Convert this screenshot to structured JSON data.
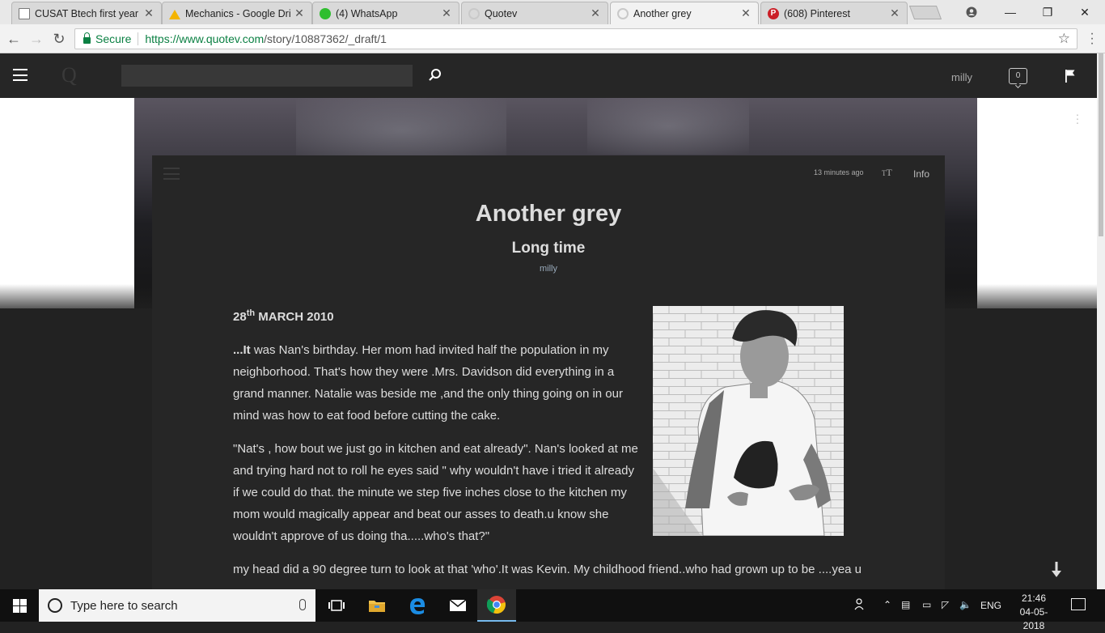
{
  "browser": {
    "tabs": [
      {
        "title": "CUSAT Btech first year n",
        "icon": "document-icon"
      },
      {
        "title": "Mechanics - Google Dri",
        "icon": "google-drive-icon"
      },
      {
        "title": "(4) WhatsApp",
        "icon": "whatsapp-icon"
      },
      {
        "title": "Quotev",
        "icon": "quotev-icon"
      },
      {
        "title": "Another grey",
        "icon": "quotev-icon",
        "active": true
      },
      {
        "title": "(608) Pinterest",
        "icon": "pinterest-icon"
      }
    ],
    "tab_close": "✕",
    "security_label": "Secure",
    "url_host": "https://www.quotev.com",
    "url_path": "/story/10887362/_draft/1"
  },
  "site": {
    "logo": "Q",
    "username": "milly",
    "notification_count": "0",
    "search_placeholder": ""
  },
  "reader": {
    "timestamp": "13 minutes ago",
    "text_size_big": "T",
    "text_size_small": "T",
    "info_label": "Info",
    "story_title": "Another grey",
    "chapter_title": "Long time",
    "author": "milly",
    "date_day": "28",
    "date_sup": "th",
    "date_rest": " MARCH 2010",
    "p1_lead": "...It",
    "p1_text": " was Nan's birthday. Her mom had invited half the population  in my neighborhood. That's how they were .Mrs. Davidson did everything in a grand manner. Natalie was beside me ,and the only thing going on in our mind was how to eat food before cutting the cake.",
    "p2_text": "\"Nat's , how bout we just go in kitchen and eat already\". Nan's looked at me and trying hard not to roll he eyes said \" why wouldn't have i tried it already if we could do that. the minute we step five inches close to the kitchen my mom would magically appear and beat our asses to death.u know she wouldn't approve of us doing tha.....who's that?\"",
    "p3_text": "my head did a 90 degree turn to look at that 'who'.It was Kevin. My childhood friend..who had grown up to be ....yea u"
  },
  "taskbar": {
    "search_placeholder": "Type here to search",
    "language": "ENG",
    "time": "21:46",
    "date": "04-05-2018"
  },
  "colors": {
    "page_bg": "#222222",
    "card_bg": "#262626",
    "header_bg": "#262626",
    "secure_green": "#0b8043"
  }
}
